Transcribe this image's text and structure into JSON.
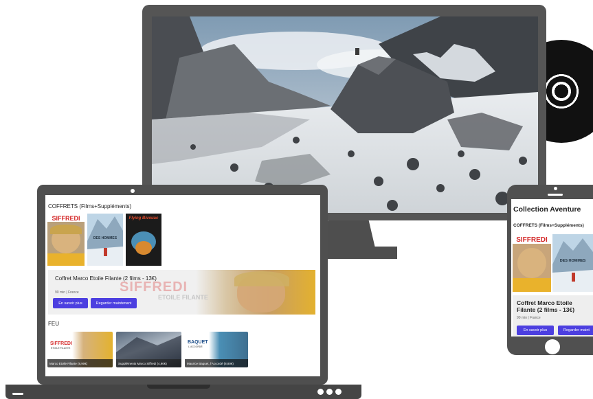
{
  "laptop": {
    "section_coffrets": "COFFRETS (Films+Suppléments)",
    "covers": [
      {
        "name": "siffredi-cover",
        "label": "SIFFREDI"
      },
      {
        "name": "des-hommes-cover",
        "label": "DES HOMMES"
      },
      {
        "name": "flying-bivouac-cover",
        "label": "Flying Bivouac"
      }
    ],
    "feature": {
      "title": "Coffret Marco Etoile Filante (2 films - 13€)",
      "meta": "90 min | France",
      "banner_title": "SIFFREDI",
      "banner_subtitle": "ETOILE FILANTE",
      "learn_more": "En savoir plus",
      "watch_now": "Regarder maintenant"
    },
    "section_feu": "FEU",
    "thumbnails": [
      {
        "caption": "Marco Etoile Filante (8,90€)",
        "logo": "SIFFREDI",
        "logo_sub": "ETOILE FILANTE"
      },
      {
        "caption": "Suppléments Marco Siffredi (4,90€)"
      },
      {
        "caption": "Maurice Baquet, l'Accordé (8,90€)",
        "logo": "BAQUET",
        "logo_sub": "L'ACCORDÉ"
      }
    ]
  },
  "phone": {
    "title": "Collection Aventure",
    "section_coffrets": "COFFRETS (Films+Suppléments)",
    "covers": [
      {
        "label": "SIFFREDI"
      },
      {
        "label": "DES HOMMES"
      }
    ],
    "feature": {
      "title": "Coffret Marco Etoile Filante (2 films - 13€)",
      "meta": "90 min | France",
      "learn_more": "En savoir plus",
      "watch_now": "Regarder maint"
    }
  }
}
